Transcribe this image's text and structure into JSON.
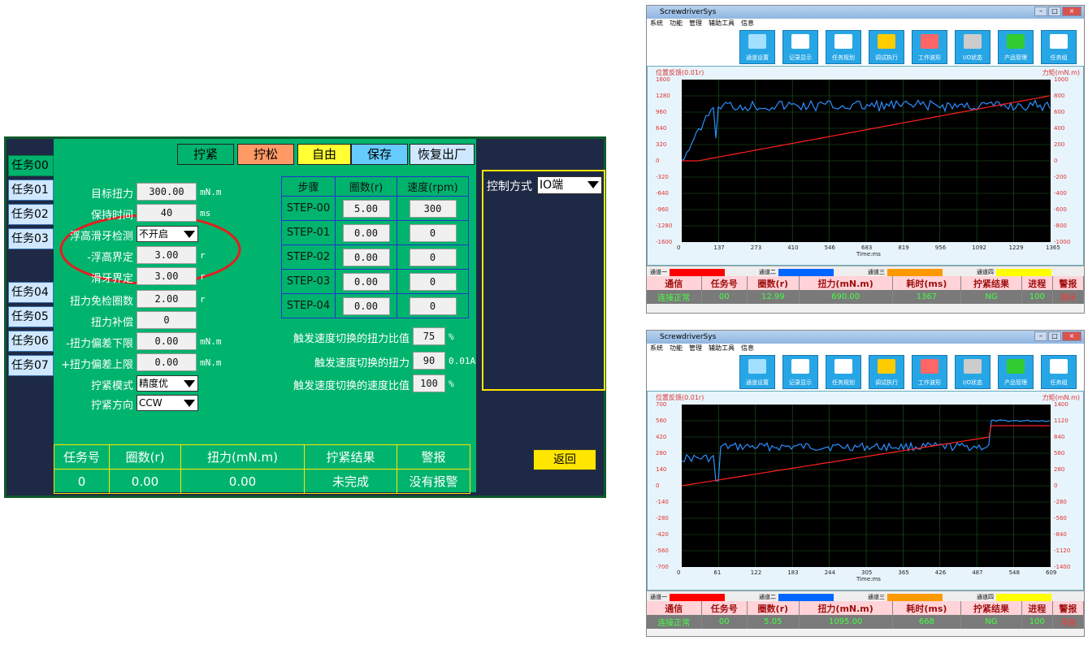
{
  "hmi": {
    "tasks": [
      "任务00",
      "任务01",
      "任务02",
      "任务03",
      "任务04",
      "任务05",
      "任务06",
      "任务07"
    ],
    "top_buttons": [
      {
        "label": "拧紧",
        "color": "#00b46e"
      },
      {
        "label": "拧松",
        "color": "#ff9966"
      },
      {
        "label": "自由",
        "color": "#ffff33"
      },
      {
        "label": "保存",
        "color": "#66ccff"
      },
      {
        "label": "恢复出厂",
        "color": "#cfe8ff"
      }
    ],
    "fields": {
      "target_torque": {
        "label": "目标扭力",
        "value": "300.00",
        "unit": "mN.m"
      },
      "hold_time": {
        "label": "保持时间",
        "value": "40",
        "unit": "ms"
      },
      "float_detect": {
        "label": "浮高滑牙检测",
        "value": "不开启"
      },
      "float_limit": {
        "label": "-浮高界定",
        "value": "3.00",
        "unit": "r"
      },
      "slip_limit": {
        "label": "滑牙界定",
        "value": "3.00",
        "unit": "r"
      },
      "torque_free_turns": {
        "label": "扭力免检圈数",
        "value": "2.00",
        "unit": "r"
      },
      "torque_comp": {
        "label": "扭力补偿",
        "value": "0"
      },
      "torque_dev_low": {
        "label": "-扭力偏差下限",
        "value": "0.00",
        "unit": "mN.m"
      },
      "torque_dev_high": {
        "label": "+扭力偏差上限",
        "value": "0.00",
        "unit": "mN.m"
      },
      "tighten_mode": {
        "label": "拧紧模式",
        "value": "精度优"
      },
      "tighten_dir": {
        "label": "拧紧方向",
        "value": "CCW"
      }
    },
    "step_table": {
      "headers": [
        "步骤",
        "圈数(r)",
        "速度(rpm)"
      ],
      "rows": [
        [
          "STEP-00",
          "5.00",
          "300"
        ],
        [
          "STEP-01",
          "0.00",
          "0"
        ],
        [
          "STEP-02",
          "0.00",
          "0"
        ],
        [
          "STEP-03",
          "0.00",
          "0"
        ],
        [
          "STEP-04",
          "0.00",
          "0"
        ]
      ]
    },
    "trigger": {
      "torque_ratio": {
        "label": "触发速度切换的扭力比值",
        "value": "75",
        "unit": "%"
      },
      "torque": {
        "label": "触发速度切换的扭力",
        "value": "90",
        "unit": "0.01A"
      },
      "speed_ratio": {
        "label": "触发速度切换的速度比值",
        "value": "100",
        "unit": "%"
      }
    },
    "control": {
      "label": "控制方式",
      "value": "IO端"
    },
    "return_label": "返回",
    "status": {
      "headers": [
        "任务号",
        "圈数(r)",
        "扭力(mN.m)",
        "拧紧结果",
        "警报"
      ],
      "values": [
        "0",
        "0.00",
        "0.00",
        "未完成",
        "没有报警"
      ]
    }
  },
  "screenshots": [
    {
      "window_title": "ScrewdriverSys",
      "menu": [
        "系统",
        "功能",
        "管理",
        "辅助工具",
        "信息"
      ],
      "tools": [
        "通道设置",
        "记录显示",
        "任务规划",
        "调试执行",
        "工作波形",
        "I/O状态",
        "产品管理",
        "任务组"
      ],
      "left_axis_title": "位置反馈(0.01r)",
      "right_axis_title": "力矩(mN.m)",
      "left_ticks": [
        "1600",
        "1280",
        "960",
        "640",
        "320",
        "0",
        "-320",
        "-640",
        "-960",
        "-1280",
        "-1600"
      ],
      "right_ticks": [
        "1000",
        "800",
        "600",
        "400",
        "200",
        "0",
        "-200",
        "-400",
        "-600",
        "-800",
        "-1000"
      ],
      "x_ticks": [
        "0",
        "137",
        "273",
        "410",
        "546",
        "683",
        "819",
        "956",
        "1092",
        "1229",
        "1365"
      ],
      "x_label": "Time:ms",
      "channels": [
        "通道一",
        "通道二",
        "通道三",
        "通道四"
      ],
      "status_headers": [
        "通信",
        "任务号",
        "圈数(r)",
        "扭力(mN.m)",
        "耗时(ms)",
        "拧紧结果",
        "进程",
        "警报"
      ],
      "status_values": [
        "连接正常",
        "00",
        "12.99",
        "690.00",
        "1367",
        "NG",
        "100",
        "滑牙"
      ]
    },
    {
      "window_title": "ScrewdriverSys",
      "menu": [
        "系统",
        "功能",
        "管理",
        "辅助工具",
        "信息"
      ],
      "tools": [
        "通道设置",
        "记录显示",
        "任务规划",
        "调试执行",
        "工作波形",
        "I/O状态",
        "产品管理",
        "任务组"
      ],
      "left_axis_title": "位置反馈(0.01r)",
      "right_axis_title": "力矩(mN.m)",
      "left_ticks": [
        "700",
        "560",
        "420",
        "280",
        "140",
        "0",
        "-140",
        "-280",
        "-420",
        "-560",
        "-700"
      ],
      "right_ticks": [
        "1400",
        "1120",
        "840",
        "560",
        "280",
        "0",
        "-280",
        "-560",
        "-840",
        "-1120",
        "-1400"
      ],
      "x_ticks": [
        "0",
        "61",
        "122",
        "183",
        "244",
        "305",
        "365",
        "426",
        "487",
        "548",
        "609"
      ],
      "x_label": "Time:ms",
      "channels": [
        "通道一",
        "通道二",
        "通道三",
        "通道四"
      ],
      "status_headers": [
        "通信",
        "任务号",
        "圈数(r)",
        "扭力(mN.m)",
        "耗时(ms)",
        "拧紧结果",
        "进程",
        "警报"
      ],
      "status_values": [
        "连接正常",
        "00",
        "5.05",
        "1095.00",
        "668",
        "NG",
        "100",
        "浮高"
      ]
    }
  ]
}
